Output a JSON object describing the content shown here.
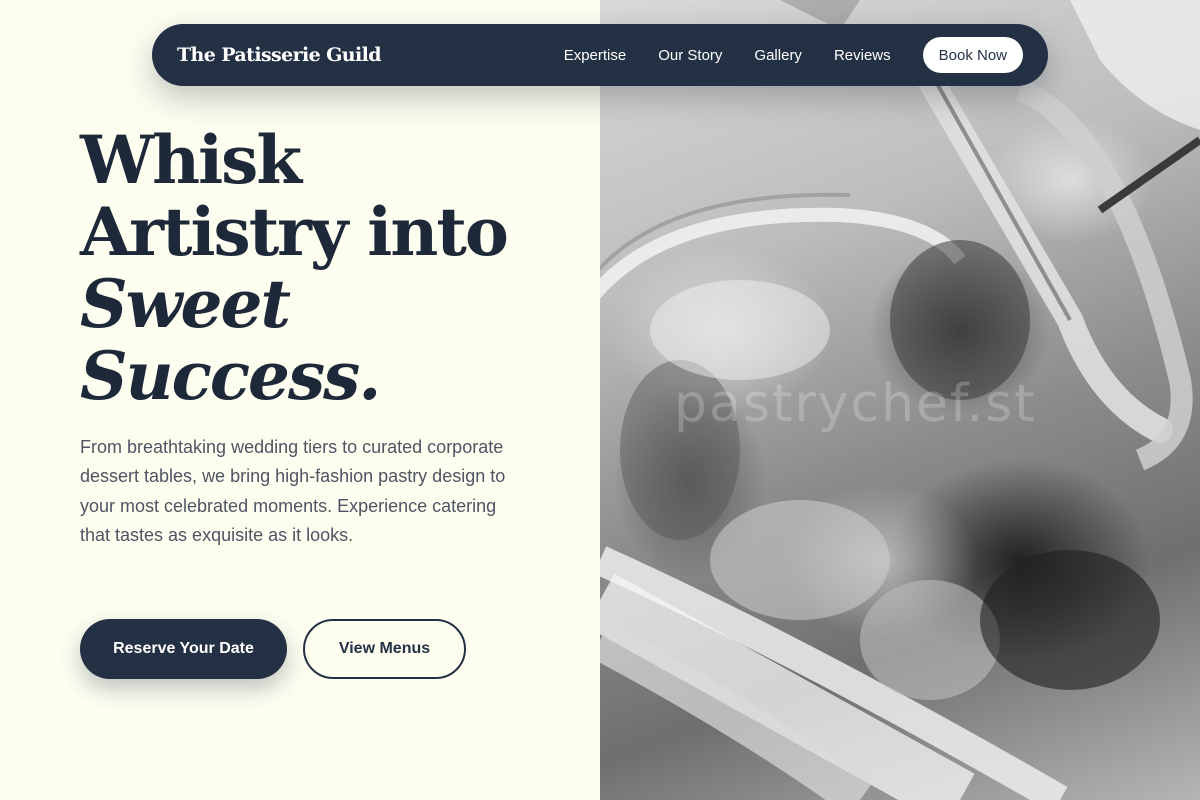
{
  "nav": {
    "brand": "The Patisserie Guild",
    "links": [
      "Expertise",
      "Our Story",
      "Gallery",
      "Reviews"
    ],
    "cta": "Book Now"
  },
  "hero": {
    "headline_lines": [
      "Whisk",
      "Artistry into",
      "Sweet",
      "Success."
    ],
    "subtext": "From breathtaking wedding tiers to curated corporate dessert tables, we bring high-fashion pastry design to your most celebrated moments. Experience catering that tastes as exquisite as it looks.",
    "primary_button": "Reserve Your Date",
    "secondary_button": "View Menus"
  },
  "image": {
    "watermark": "pastrychef.st",
    "description_icon": "food-photo"
  },
  "colors": {
    "background": "#fdfdf0",
    "navy": "#243144",
    "headline": "#1d2839",
    "body_text": "#4f5563"
  }
}
